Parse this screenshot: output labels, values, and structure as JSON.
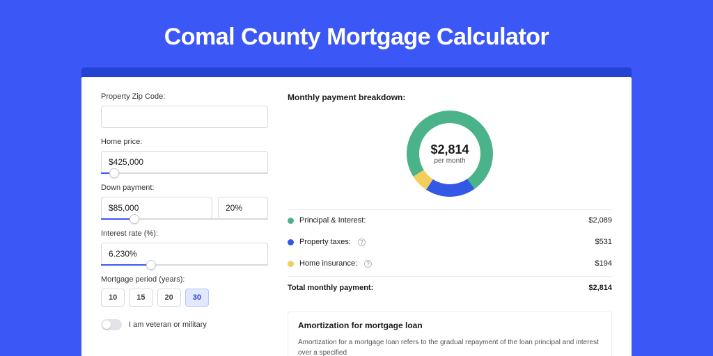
{
  "page": {
    "title": "Comal County Mortgage Calculator"
  },
  "form": {
    "zip_label": "Property Zip Code:",
    "zip_value": "",
    "home_price_label": "Home price:",
    "home_price_value": "$425,000",
    "home_price_slider_pct": 8,
    "down_payment_label": "Down payment:",
    "down_payment_value": "$85,000",
    "down_payment_pct_value": "20%",
    "down_payment_slider_pct": 20,
    "interest_label": "Interest rate (%):",
    "interest_value": "6.230%",
    "interest_slider_pct": 30,
    "period_label": "Mortgage period (years):",
    "period_options": [
      {
        "label": "10",
        "selected": false
      },
      {
        "label": "15",
        "selected": false
      },
      {
        "label": "20",
        "selected": false
      },
      {
        "label": "30",
        "selected": true
      }
    ],
    "veteran_label": "I am veteran or military",
    "veteran_value": false
  },
  "breakdown": {
    "title": "Monthly payment breakdown:",
    "center_value": "$2,814",
    "center_sub": "per month",
    "items": [
      {
        "label": "Principal & Interest:",
        "value": "$2,089",
        "amount": 2089,
        "color": "#4bb38a",
        "has_info": false
      },
      {
        "label": "Property taxes:",
        "value": "$531",
        "amount": 531,
        "color": "#3358e6",
        "has_info": true
      },
      {
        "label": "Home insurance:",
        "value": "$194",
        "amount": 194,
        "color": "#f2cf5b",
        "has_info": true
      }
    ],
    "total_label": "Total monthly payment:",
    "total_value": "$2,814",
    "total_amount": 2814
  },
  "amortization": {
    "title": "Amortization for mortgage loan",
    "text": "Amortization for a mortgage loan refers to the gradual repayment of the loan principal and interest over a specified"
  },
  "chart_data": {
    "type": "pie",
    "title": "Monthly payment breakdown",
    "categories": [
      "Principal & Interest",
      "Property taxes",
      "Home insurance"
    ],
    "values": [
      2089,
      531,
      194
    ],
    "colors": [
      "#4bb38a",
      "#3358e6",
      "#f2cf5b"
    ],
    "total": 2814,
    "unit": "USD per month"
  }
}
